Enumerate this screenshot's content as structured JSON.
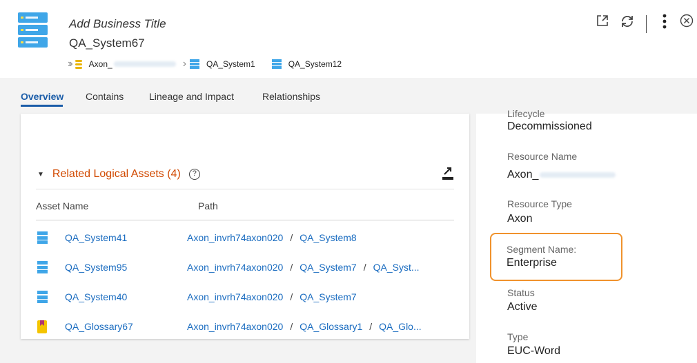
{
  "header": {
    "business_title": "Add Business Title",
    "asset_name": "QA_System67",
    "breadcrumb": {
      "item1": "Axon_",
      "item2": "QA_System1",
      "item3": "QA_System12"
    },
    "icons": [
      "system-icon",
      "open-new-window-icon",
      "refresh-icon",
      "more-vert-icon",
      "close-circle-icon"
    ]
  },
  "tabs": [
    "Overview",
    "Contains",
    "Lineage and Impact",
    "Relationships"
  ],
  "related": {
    "title": "Related Logical Assets (4)",
    "columns": [
      "Asset Name",
      "Path"
    ],
    "rows": [
      {
        "icon": "system-icon",
        "name": "QA_System41",
        "path": [
          "Axon_invrh74axon020",
          "QA_System8"
        ]
      },
      {
        "icon": "system-icon",
        "name": "QA_System95",
        "path": [
          "Axon_invrh74axon020",
          "QA_System7",
          "QA_Syst..."
        ]
      },
      {
        "icon": "system-icon",
        "name": "QA_System40",
        "path": [
          "Axon_invrh74axon020",
          "QA_System7"
        ]
      },
      {
        "icon": "glossary-icon",
        "name": "QA_Glossary67",
        "path": [
          "Axon_invrh74axon020",
          "QA_Glossary1",
          "QA_Glo..."
        ]
      }
    ]
  },
  "properties": {
    "lifecycle_label": "Lifecycle",
    "lifecycle_value": "Decommissioned",
    "resource_name_label": "Resource Name",
    "resource_name_value": "Axon_",
    "resource_type_label": "Resource Type",
    "resource_type_value": "Axon",
    "segment_label": "Segment Name:",
    "segment_value": "Enterprise",
    "status_label": "Status",
    "status_value": "Active",
    "type_label": "Type",
    "type_value": "EUC-Word"
  },
  "colors": {
    "accent": "#1a5ca8",
    "link": "#1a6cc0",
    "section_title": "#d14900",
    "highlight_border": "#f0922c"
  }
}
